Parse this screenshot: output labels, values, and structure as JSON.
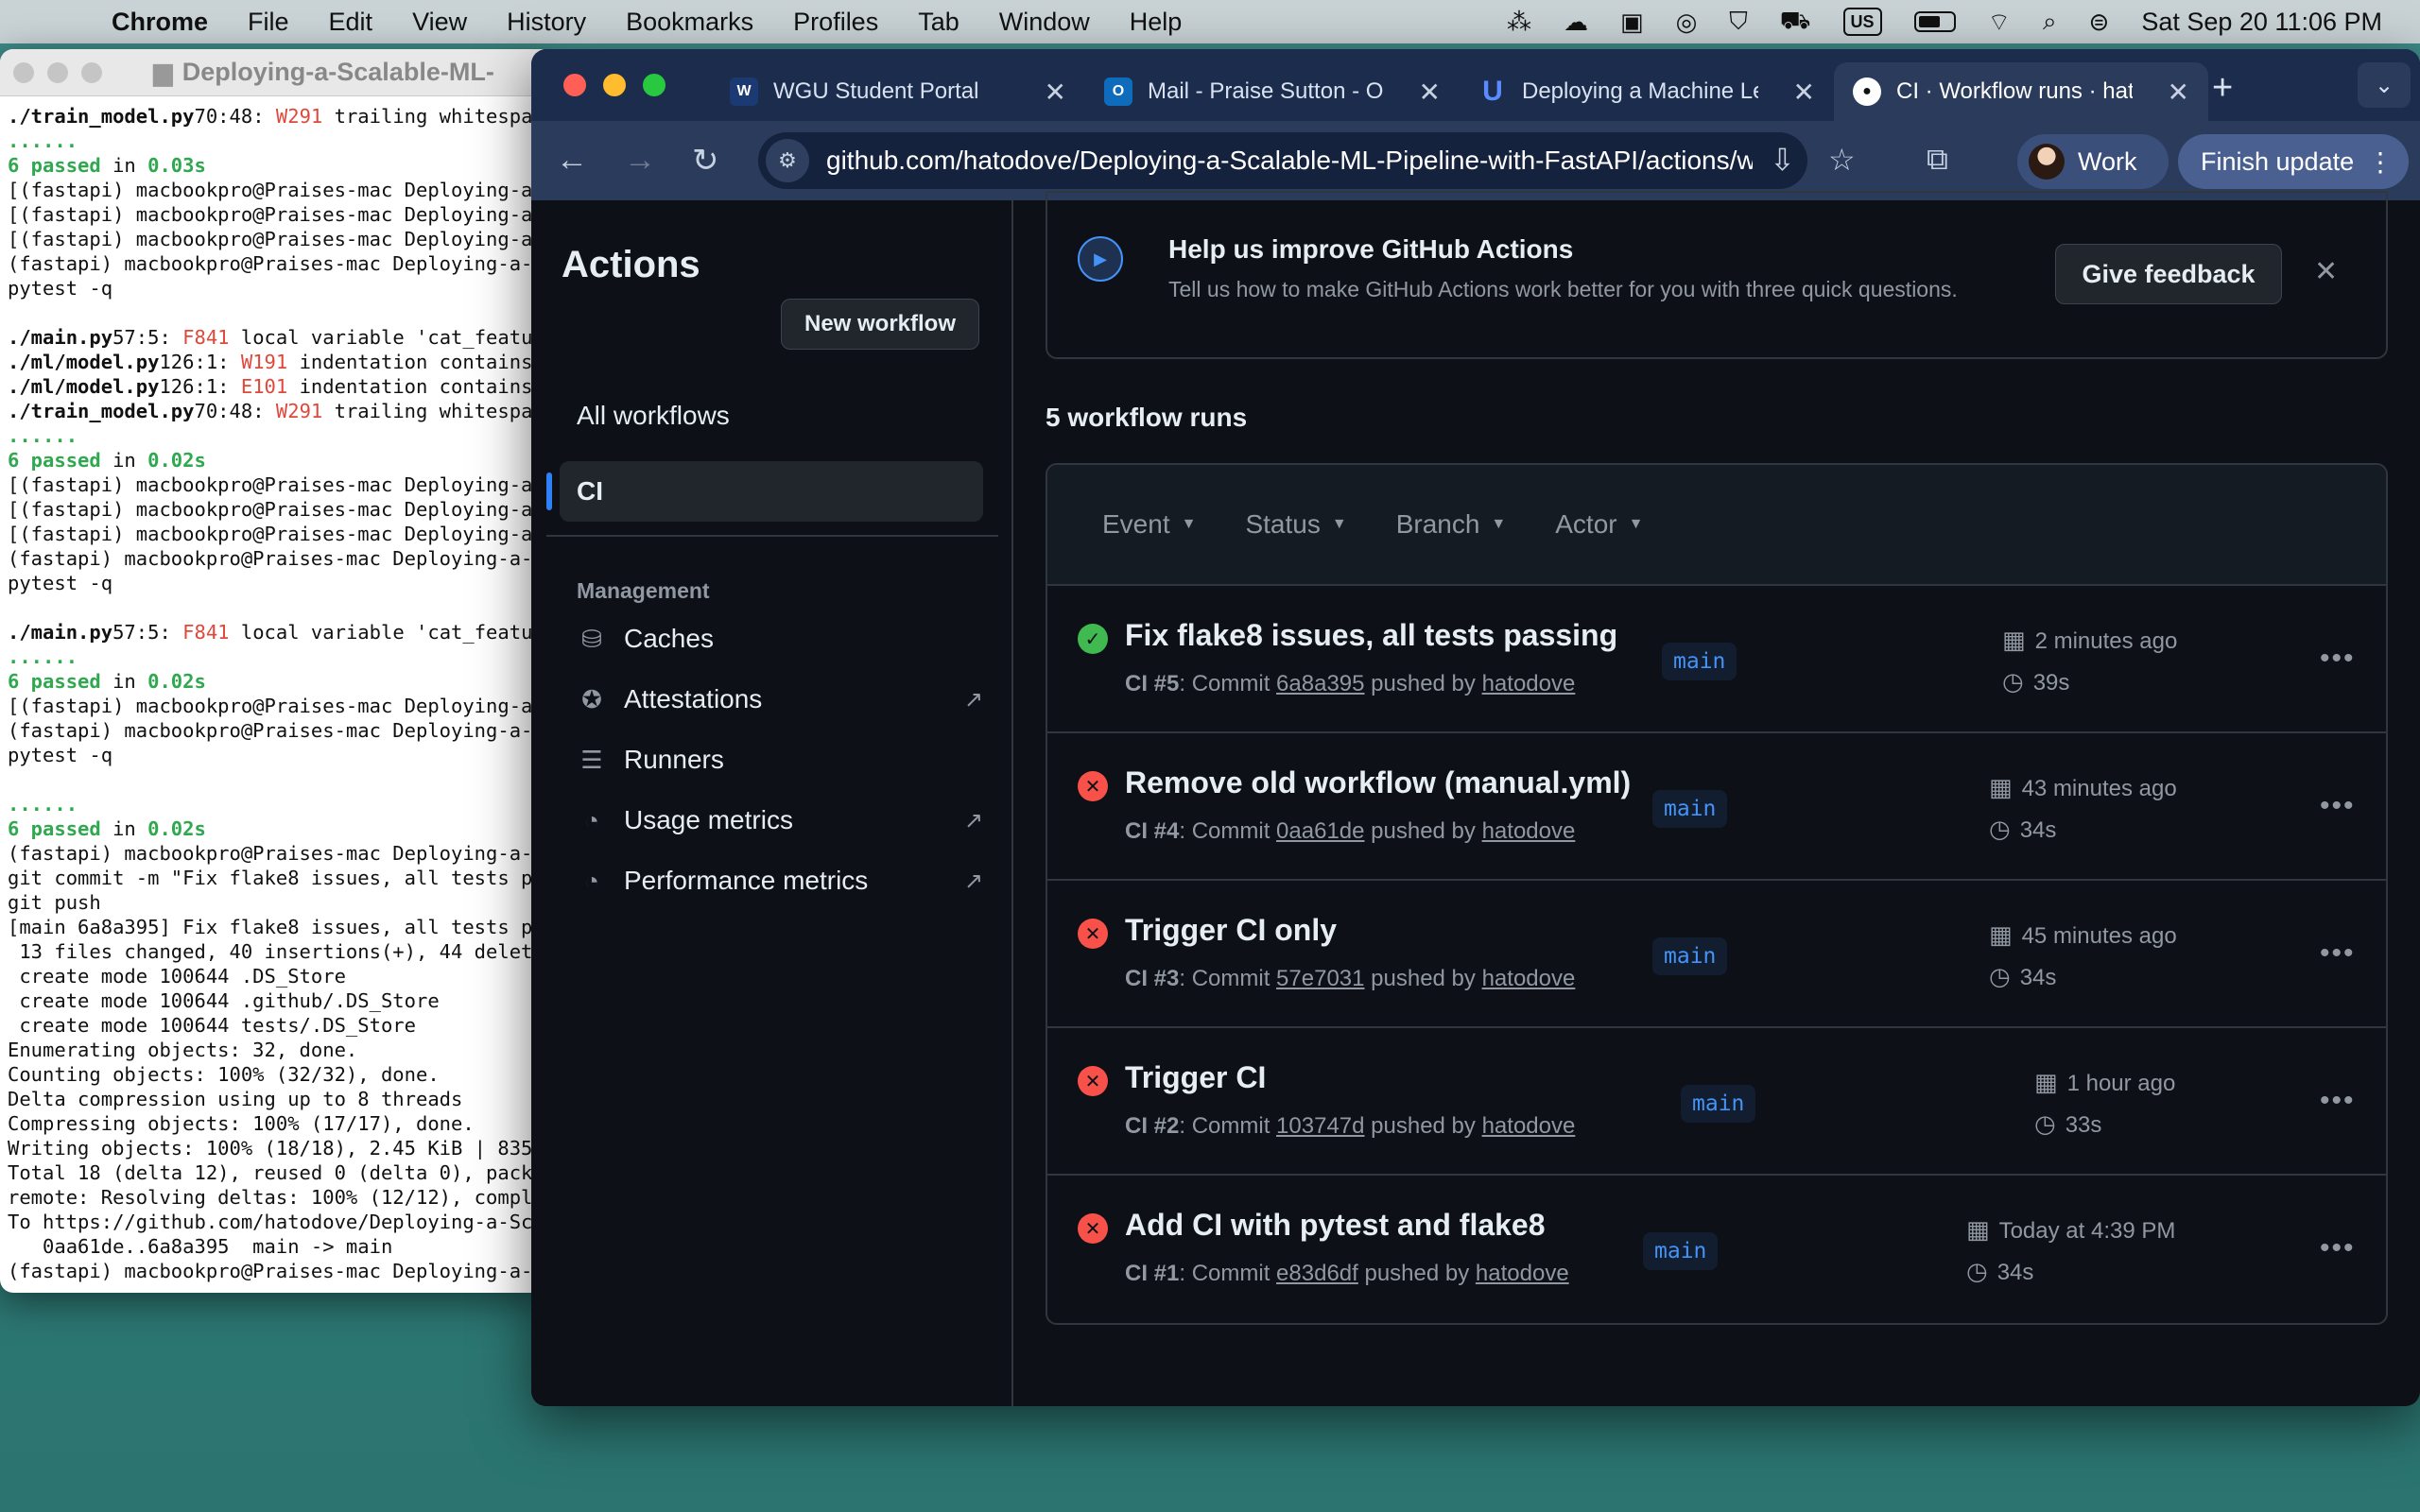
{
  "menubar": {
    "app": "Chrome",
    "items": [
      "File",
      "Edit",
      "View",
      "History",
      "Bookmarks",
      "Profiles",
      "Tab",
      "Window",
      "Help"
    ],
    "input_source": "US",
    "clock": "Sat Sep 20  11:06 PM"
  },
  "terminal": {
    "title": "Deploying-a-Scalable-ML-",
    "lines": [
      [
        [
          "b",
          "./train_model.py"
        ],
        [
          "",
          "70:48: "
        ],
        [
          "r",
          "W291"
        ],
        [
          "",
          " trailing whitespa"
        ]
      ],
      [
        [
          "g",
          "......"
        ]
      ],
      [
        [
          "g",
          "6 passed"
        ],
        [
          "",
          " in "
        ],
        [
          "g",
          "0.03s"
        ]
      ],
      [
        [
          "",
          "[(fastapi) macbookpro@Praises-mac Deploying-a-S"
        ]
      ],
      [
        [
          "",
          "[(fastapi) macbookpro@Praises-mac Deploying-a-S"
        ]
      ],
      [
        [
          "",
          "[(fastapi) macbookpro@Praises-mac Deploying-a-S"
        ]
      ],
      [
        [
          "",
          "(fastapi) macbookpro@Praises-mac Deploying-a-S"
        ]
      ],
      [
        [
          "",
          "pytest -q"
        ]
      ],
      [
        [
          "",
          ""
        ]
      ],
      [
        [
          "b",
          "./main.py"
        ],
        [
          "",
          "57:5: "
        ],
        [
          "r",
          "F841"
        ],
        [
          "",
          " local variable 'cat_featu"
        ]
      ],
      [
        [
          "b",
          "./ml/model.py"
        ],
        [
          "",
          "126:1: "
        ],
        [
          "r",
          "W191"
        ],
        [
          "",
          " indentation contains"
        ]
      ],
      [
        [
          "b",
          "./ml/model.py"
        ],
        [
          "",
          "126:1: "
        ],
        [
          "r",
          "E101"
        ],
        [
          "",
          " indentation contains"
        ]
      ],
      [
        [
          "b",
          "./train_model.py"
        ],
        [
          "",
          "70:48: "
        ],
        [
          "r",
          "W291"
        ],
        [
          "",
          " trailing whitespa"
        ]
      ],
      [
        [
          "g",
          "......"
        ]
      ],
      [
        [
          "g",
          "6 passed"
        ],
        [
          "",
          " in "
        ],
        [
          "g",
          "0.02s"
        ]
      ],
      [
        [
          "",
          "[(fastapi) macbookpro@Praises-mac Deploying-a-S"
        ]
      ],
      [
        [
          "",
          "[(fastapi) macbookpro@Praises-mac Deploying-a-S"
        ]
      ],
      [
        [
          "",
          "[(fastapi) macbookpro@Praises-mac Deploying-a-S"
        ]
      ],
      [
        [
          "",
          "(fastapi) macbookpro@Praises-mac Deploying-a-S"
        ]
      ],
      [
        [
          "",
          "pytest -q"
        ]
      ],
      [
        [
          "",
          ""
        ]
      ],
      [
        [
          "b",
          "./main.py"
        ],
        [
          "",
          "57:5: "
        ],
        [
          "r",
          "F841"
        ],
        [
          "",
          " local variable 'cat_featu"
        ]
      ],
      [
        [
          "g",
          "......"
        ]
      ],
      [
        [
          "g",
          "6 passed"
        ],
        [
          "",
          " in "
        ],
        [
          "g",
          "0.02s"
        ]
      ],
      [
        [
          "",
          "[(fastapi) macbookpro@Praises-mac Deploying-a-S"
        ]
      ],
      [
        [
          "",
          "(fastapi) macbookpro@Praises-mac Deploying-a-S"
        ]
      ],
      [
        [
          "",
          "pytest -q"
        ]
      ],
      [
        [
          "",
          ""
        ]
      ],
      [
        [
          "g",
          "......"
        ]
      ],
      [
        [
          "g",
          "6 passed"
        ],
        [
          "",
          " in "
        ],
        [
          "g",
          "0.02s"
        ]
      ],
      [
        [
          "",
          "(fastapi) macbookpro@Praises-mac Deploying-a-S"
        ]
      ],
      [
        [
          "",
          "git commit -m \"Fix flake8 issues, all tests pa"
        ]
      ],
      [
        [
          "",
          "git push"
        ]
      ],
      [
        [
          "",
          "[main 6a8a395] Fix flake8 issues, all tests pa"
        ]
      ],
      [
        [
          "",
          " 13 files changed, 40 insertions(+), 44 deleti"
        ]
      ],
      [
        [
          "",
          " create mode 100644 .DS_Store"
        ]
      ],
      [
        [
          "",
          " create mode 100644 .github/.DS_Store"
        ]
      ],
      [
        [
          "",
          " create mode 100644 tests/.DS_Store"
        ]
      ],
      [
        [
          "",
          "Enumerating objects: 32, done."
        ]
      ],
      [
        [
          "",
          "Counting objects: 100% (32/32), done."
        ]
      ],
      [
        [
          "",
          "Delta compression using up to 8 threads"
        ]
      ],
      [
        [
          "",
          "Compressing objects: 100% (17/17), done."
        ]
      ],
      [
        [
          "",
          "Writing objects: 100% (18/18), 2.45 KiB | 835."
        ]
      ],
      [
        [
          "",
          "Total 18 (delta 12), reused 0 (delta 0), pack-"
        ]
      ],
      [
        [
          "",
          "remote: Resolving deltas: 100% (12/12), comple"
        ]
      ],
      [
        [
          "",
          "To https://github.com/hatodove/Deploying-a-Sca"
        ]
      ],
      [
        [
          "",
          "   0aa61de..6a8a395  main -> main"
        ]
      ],
      [
        [
          "",
          "(fastapi) macbookpro@Praises-mac Deploying-a-S"
        ]
      ]
    ]
  },
  "browser": {
    "tabs": [
      {
        "label": "WGU Student Portal",
        "icon": "wgu-icon",
        "active": false
      },
      {
        "label": "Mail - Praise Sutton - Outlook",
        "icon": "outlook-icon",
        "active": false
      },
      {
        "label": "Deploying a Machine Learning Model",
        "icon": "udacity-icon",
        "active": false
      },
      {
        "label": "CI · Workflow runs · hatodove",
        "icon": "github-icon",
        "active": true
      }
    ],
    "url": "github.com/hatodove/Deploying-a-Scalable-ML-Pipeline-with-FastAPI/actions/workflows/ci.yml",
    "profile_label": "Work",
    "finish_update_label": "Finish update"
  },
  "sidebar": {
    "title": "Actions",
    "new_workflow": "New workflow",
    "all_workflows": "All workflows",
    "selected_workflow": "CI",
    "management_heading": "Management",
    "items": [
      {
        "label": "Caches",
        "icon": "database-icon",
        "external": false
      },
      {
        "label": "Attestations",
        "icon": "verified-icon",
        "external": true
      },
      {
        "label": "Runners",
        "icon": "server-icon",
        "external": false
      },
      {
        "label": "Usage metrics",
        "icon": "meter-icon",
        "external": true
      },
      {
        "label": "Performance metrics",
        "icon": "meter-icon",
        "external": true
      }
    ]
  },
  "banner": {
    "title": "Help us improve GitHub Actions",
    "description": "Tell us how to make GitHub Actions work better for you with three quick questions.",
    "feedback_button": "Give feedback"
  },
  "runs": {
    "count_label": "5 workflow runs",
    "filters": [
      "Event",
      "Status",
      "Branch",
      "Actor"
    ],
    "items": [
      {
        "title": "Fix flake8 issues, all tests passing",
        "status": "success",
        "workflow": "CI",
        "number": "#5",
        "commit": "6a8a395",
        "actor": "hatodove",
        "branch": "main",
        "when": "2 minutes ago",
        "duration": "39s"
      },
      {
        "title": "Remove old workflow (manual.yml)",
        "status": "failure",
        "workflow": "CI",
        "number": "#4",
        "commit": "0aa61de",
        "actor": "hatodove",
        "branch": "main",
        "when": "43 minutes ago",
        "duration": "34s"
      },
      {
        "title": "Trigger CI only",
        "status": "failure",
        "workflow": "CI",
        "number": "#3",
        "commit": "57e7031",
        "actor": "hatodove",
        "branch": "main",
        "when": "45 minutes ago",
        "duration": "34s"
      },
      {
        "title": "Trigger CI",
        "status": "failure",
        "workflow": "CI",
        "number": "#2",
        "commit": "103747d",
        "actor": "hatodove",
        "branch": "main",
        "when": "1 hour ago",
        "duration": "33s"
      },
      {
        "title": "Add CI with pytest and flake8",
        "status": "failure",
        "workflow": "CI",
        "number": "#1",
        "commit": "e83d6df",
        "actor": "hatodove",
        "branch": "main",
        "when": "Today at 4:39 PM",
        "duration": "34s"
      }
    ]
  }
}
